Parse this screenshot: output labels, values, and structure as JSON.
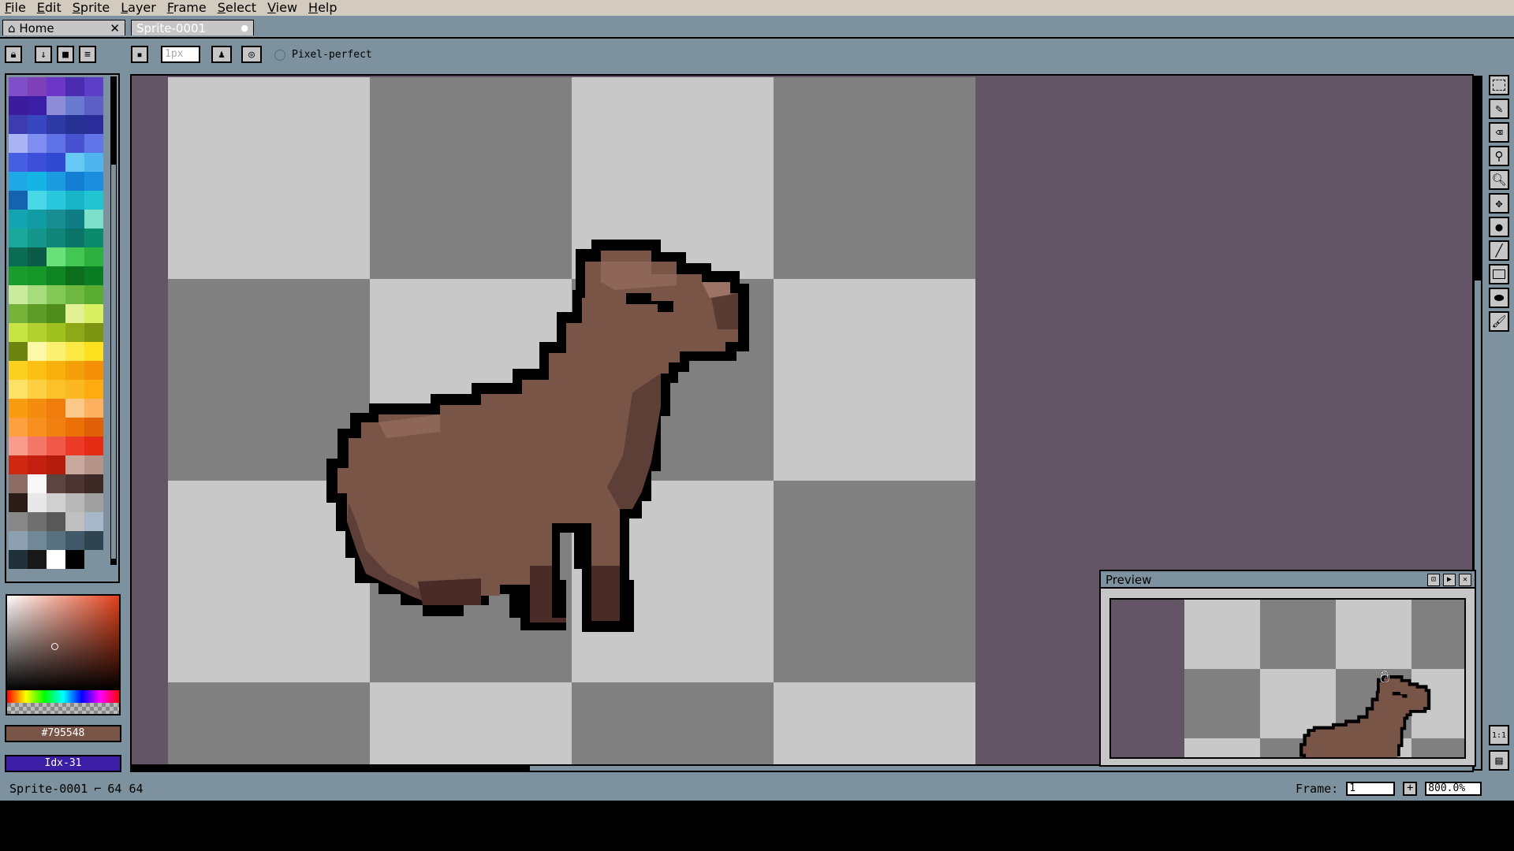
{
  "menu": [
    "File",
    "Edit",
    "Sprite",
    "Layer",
    "Frame",
    "Select",
    "View",
    "Help"
  ],
  "tabs": {
    "home": "Home",
    "home_close": "✕",
    "sprite": "Sprite-0001",
    "sprite_dot": "●"
  },
  "toolbar": {
    "brush_size_placeholder": "1px",
    "pixel_perfect_label": "Pixel-perfect"
  },
  "palette": {
    "colors": [
      "#7e4fc8",
      "#7d40b9",
      "#6b36c8",
      "#4b2bb0",
      "#5b3fc8",
      "#3b1c9c",
      "#3a1fa6",
      "#8c8cd8",
      "#6a7ad0",
      "#5d5fc4",
      "#3c3cb0",
      "#3747c0",
      "#2d3aa6",
      "#253294",
      "#2a2c9a",
      "#a8b4f4",
      "#7d8ef0",
      "#5f72e6",
      "#4752d0",
      "#6275e8",
      "#455ee2",
      "#3d4fd8",
      "#2f49d0",
      "#68c8f4",
      "#50b4ee",
      "#1fa8e6",
      "#14b4e4",
      "#1b9ce0",
      "#137ed4",
      "#1c8ee0",
      "#1462b0",
      "#4ad8e6",
      "#2ac8dc",
      "#18b4c8",
      "#22c4d2",
      "#12a4b0",
      "#119ca4",
      "#178e92",
      "#0e7e84",
      "#7ee0c8",
      "#1aa89a",
      "#15968a",
      "#0f8678",
      "#0b7468",
      "#0c8a6c",
      "#0b6c54",
      "#0a5c48",
      "#6ae07a",
      "#42c852",
      "#2eb040",
      "#1a9c2c",
      "#149628",
      "#0e8422",
      "#0a6e1c",
      "#0a7c24",
      "#c8ec9c",
      "#a6dc7c",
      "#84c858",
      "#6cb840",
      "#5aac30",
      "#74b238",
      "#5e9c28",
      "#4e8c1c",
      "#e4f094",
      "#d8f062",
      "#c8e444",
      "#b4d030",
      "#a0c020",
      "#8ea818",
      "#7c9410",
      "#6e8410",
      "#fcf8a8",
      "#fcf070",
      "#fce844",
      "#fce020",
      "#fcd020",
      "#fcc014",
      "#f8b00c",
      "#f4a008",
      "#f49008",
      "#fce068",
      "#fcd040",
      "#fcc028",
      "#fcb820",
      "#fcac10",
      "#f89c10",
      "#f48c10",
      "#f07c0c",
      "#fcc888",
      "#fcb060",
      "#fca040",
      "#f89020",
      "#f08010",
      "#ec7008",
      "#e06008",
      "#f89c8c",
      "#f47868",
      "#f05848",
      "#ec3c28",
      "#e42c14",
      "#d02810",
      "#c42010",
      "#b41c0c",
      "#c8a89c",
      "#b49488",
      "#8c6c64",
      "#f8f8f8",
      "#5c4440",
      "#4c3430",
      "#3c2824",
      "#2c1c18",
      "#e8e8e8",
      "#d0d0d0",
      "#b8b8b8",
      "#a0a0a0",
      "#888888",
      "#707070",
      "#585858",
      "#c0c0c0",
      "#a8b8c8",
      "#8ca0b0",
      "#708898",
      "#587080",
      "#405868",
      "#304450",
      "#203038",
      "#181818",
      "#ffffff",
      "#000000"
    ]
  },
  "color": {
    "hex": "#795548",
    "index": "Idx-31"
  },
  "preview": {
    "title": "Preview"
  },
  "status": {
    "sprite_name": "Sprite-0001",
    "size": "64 64",
    "frame_label": "Frame:",
    "frame_value": "1",
    "plus": "+",
    "zoom": "800.0%"
  },
  "zoom_reset": "1:1"
}
